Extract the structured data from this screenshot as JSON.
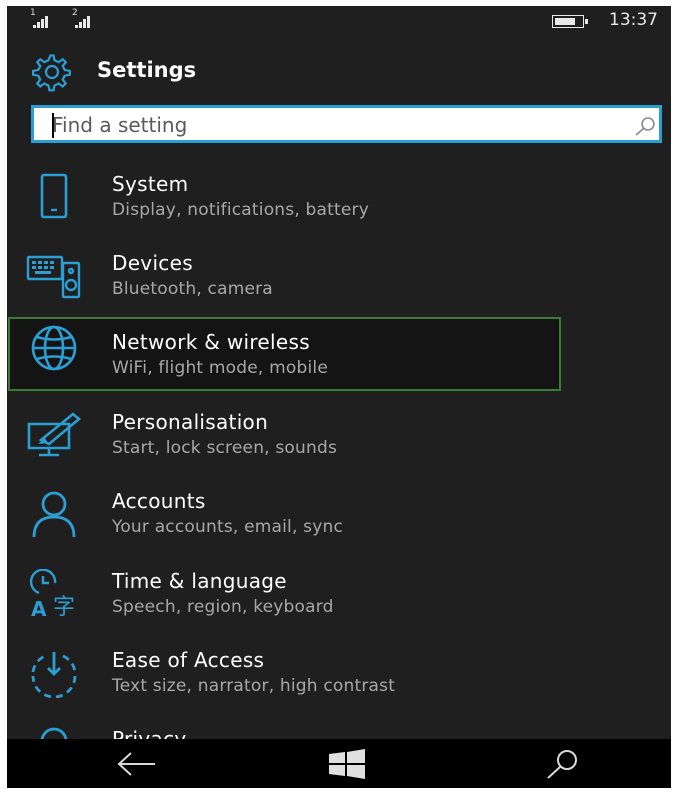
{
  "status": {
    "sim1": "1",
    "sim2": "2",
    "time": "13:37"
  },
  "header": {
    "title": "Settings",
    "icon": "gear-icon"
  },
  "search": {
    "placeholder": "Find a setting",
    "value": ""
  },
  "items": [
    {
      "label": "System",
      "sub": "Display, notifications, battery",
      "icon": "phone-icon"
    },
    {
      "label": "Devices",
      "sub": "Bluetooth, camera",
      "icon": "devices-icon"
    },
    {
      "label": "Network & wireless",
      "sub": "WiFi, flight mode, mobile",
      "icon": "globe-icon"
    },
    {
      "label": "Personalisation",
      "sub": "Start, lock screen, sounds",
      "icon": "paint-icon"
    },
    {
      "label": "Accounts",
      "sub": "Your accounts, email, sync",
      "icon": "person-icon"
    },
    {
      "label": "Time & language",
      "sub": "Speech, region, keyboard",
      "icon": "time-language-icon"
    },
    {
      "label": "Ease of Access",
      "sub": "Text size, narrator, high contrast",
      "icon": "ease-of-access-icon"
    },
    {
      "label": "Privacy",
      "sub": "",
      "icon": "lock-icon"
    }
  ],
  "colors": {
    "accent": "#2b9ed4",
    "background": "#1f1f1f",
    "selection": "#3d7a3a"
  }
}
